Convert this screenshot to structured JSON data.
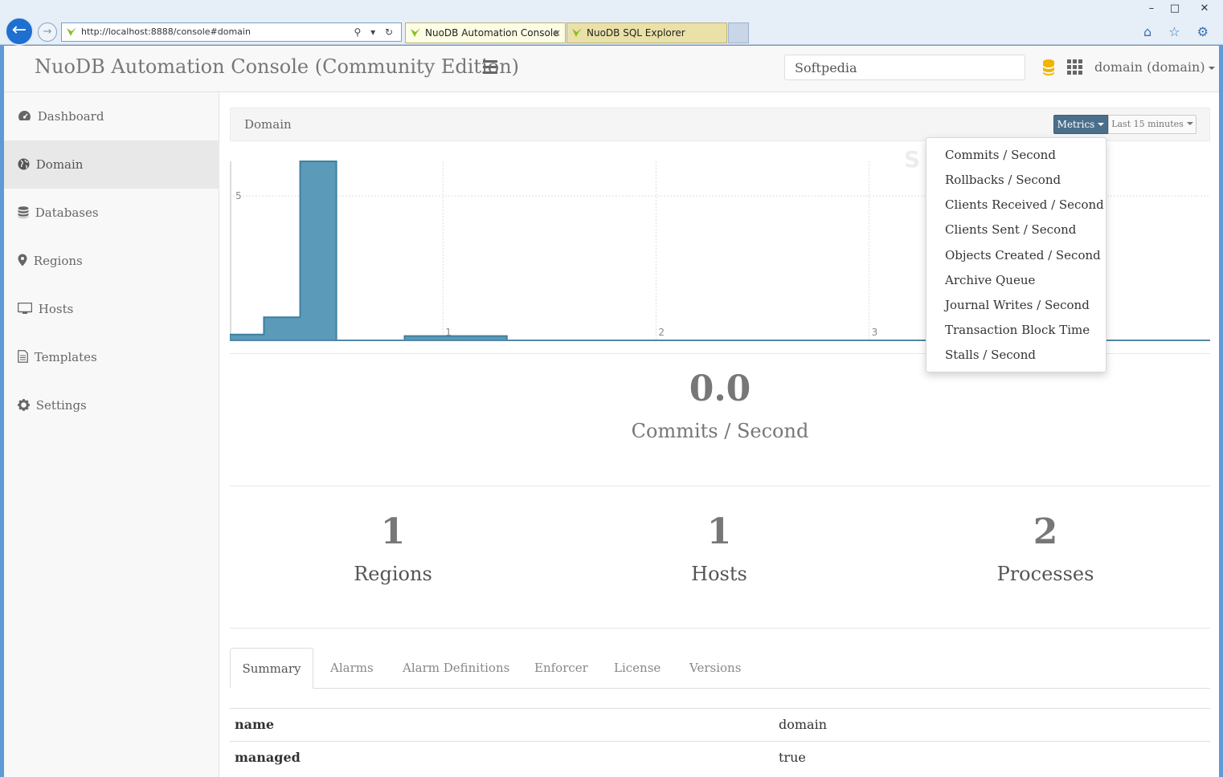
{
  "browser": {
    "url": "http://localhost:8888/console#domain",
    "tabs": [
      {
        "label": "NuoDB Automation Console",
        "close": "×"
      },
      {
        "label": "NuoDB SQL Explorer"
      }
    ],
    "window": {
      "minimize": "–",
      "maximize": "□",
      "close": "✕"
    },
    "nav_icons": "⌂ ☆ ⚙",
    "address_actions": "⚲ ▾ ↻"
  },
  "header": {
    "brand": "NuoDB Automation Console (Community Edition)",
    "search_value": "Softpedia",
    "domain_menu": "domain (domain)"
  },
  "sidebar": {
    "items": [
      {
        "label": "Dashboard",
        "icon": "dashboard-icon"
      },
      {
        "label": "Domain",
        "icon": "globe-icon",
        "active": true
      },
      {
        "label": "Databases",
        "icon": "database-icon"
      },
      {
        "label": "Regions",
        "icon": "map-marker-icon"
      },
      {
        "label": "Hosts",
        "icon": "monitor-icon"
      },
      {
        "label": "Templates",
        "icon": "file-icon"
      },
      {
        "label": "Settings",
        "icon": "gear-icon"
      }
    ]
  },
  "panel": {
    "title": "Domain",
    "metrics_label": "Metrics",
    "range_label": "Last 15 minutes"
  },
  "metrics_menu": [
    "Commits / Second",
    "Rollbacks / Second",
    "Clients Received / Second",
    "Clients Sent / Second",
    "Objects Created / Second",
    "Archive Queue",
    "Journal Writes / Second",
    "Transaction Block Time",
    "Stalls / Second"
  ],
  "chart_data": {
    "type": "area",
    "x": [
      0,
      0.16,
      0.16,
      0.33,
      0.33,
      0.5,
      0.5,
      0.82,
      0.82,
      1.3,
      1.3,
      4.6
    ],
    "y": [
      0.2,
      0.2,
      0.8,
      0.8,
      6.2,
      6.2,
      0,
      0,
      0.15,
      0.15,
      0,
      0
    ],
    "x_ticks": [
      1,
      2,
      3
    ],
    "y_ticks": [
      5
    ],
    "xlim": [
      0,
      4.6
    ],
    "ylim": [
      0,
      6.2
    ],
    "grid": true,
    "color": "#5b9ab8"
  },
  "current": {
    "value": "0.0",
    "label": "Commits / Second"
  },
  "stats": [
    {
      "value": "1",
      "label": "Regions"
    },
    {
      "value": "1",
      "label": "Hosts"
    },
    {
      "value": "2",
      "label": "Processes"
    }
  ],
  "tabs": [
    "Summary",
    "Alarms",
    "Alarm Definitions",
    "Enforcer",
    "License",
    "Versions"
  ],
  "summary": [
    {
      "key": "name",
      "value": "domain"
    },
    {
      "key": "managed",
      "value": "true"
    }
  ],
  "watermark": "SOFTPEDIA",
  "colors": {
    "accent": "#4a6f8a",
    "chart": "#5b9ab8",
    "db_icon": "#f0b400"
  }
}
